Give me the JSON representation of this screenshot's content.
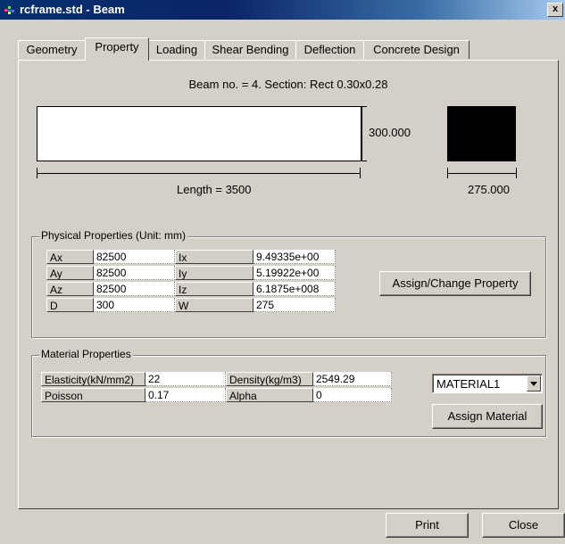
{
  "window": {
    "title": "rcframe.std - Beam",
    "close_glyph": "x",
    "app_icon": "staad-icon"
  },
  "tabs": [
    {
      "label": "Geometry",
      "active": false
    },
    {
      "label": "Property",
      "active": true
    },
    {
      "label": "Loading",
      "active": false
    },
    {
      "label": "Shear Bending",
      "active": false
    },
    {
      "label": "Deflection",
      "active": false
    },
    {
      "label": "Concrete Design",
      "active": false
    }
  ],
  "section": {
    "caption": "Beam no. = 4. Section: Rect 0.30x0.28",
    "height_label": "300.000",
    "length_label": "Length = 3500",
    "width_label": "275.000"
  },
  "physical": {
    "title": "Physical Properties (Unit: mm)",
    "rows": [
      {
        "l1": "Ax",
        "v1": "82500",
        "l2": "Ix",
        "v2": "9.49335e+00"
      },
      {
        "l1": "Ay",
        "v1": "82500",
        "l2": "Iy",
        "v2": "5.19922e+00"
      },
      {
        "l1": "Az",
        "v1": "82500",
        "l2": "Iz",
        "v2": "6.1875e+008"
      },
      {
        "l1": "D",
        "v1": "300",
        "l2": "W",
        "v2": "275"
      }
    ],
    "assign_button": "Assign/Change Property"
  },
  "material": {
    "title": "Material Properties",
    "rows": [
      {
        "l1": "Elasticity(kN/mm2)",
        "v1": "22",
        "l2": "Density(kg/m3)",
        "v2": "2549.29"
      },
      {
        "l1": "Poisson",
        "v1": "0.17",
        "l2": "Alpha",
        "v2": "0"
      }
    ],
    "material_select": "MATERIAL1",
    "assign_button": "Assign Material"
  },
  "footer": {
    "print_button": "Print",
    "close_button": "Close"
  }
}
